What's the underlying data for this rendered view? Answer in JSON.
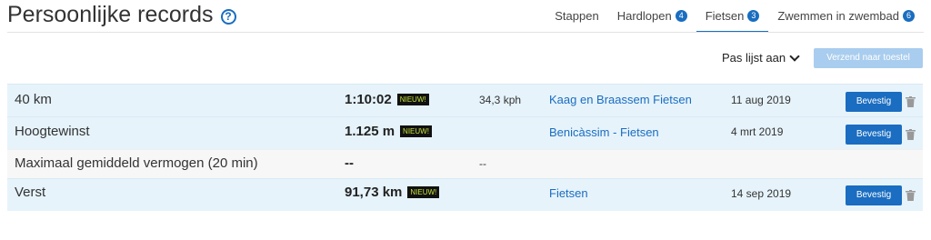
{
  "header": {
    "title": "Persoonlijke records",
    "help_icon": "question-circle-icon"
  },
  "tabs": [
    {
      "label": "Stappen",
      "count": null,
      "active": false
    },
    {
      "label": "Hardlopen",
      "count": "4",
      "active": false
    },
    {
      "label": "Fietsen",
      "count": "3",
      "active": true
    },
    {
      "label": "Zwemmen in zwembad",
      "count": "6",
      "active": false
    }
  ],
  "toolbar": {
    "adjust_label": "Pas lijst aan",
    "send_label": "Verzend naar toestel"
  },
  "rows": [
    {
      "name": "40 km",
      "value": "1:10:02",
      "badge": "NIEUW!",
      "speed": "34,3 kph",
      "activity": "Kaag en Braassem Fietsen",
      "date": "11 aug 2019",
      "confirm": "Bevestig"
    },
    {
      "name": "Hoogtewinst",
      "value": "1.125 m",
      "badge": "NIEUW!",
      "speed": "",
      "activity": "Benicàssim - Fietsen",
      "date": "4 mrt 2019",
      "confirm": "Bevestig"
    },
    {
      "name": "Maximaal gemiddeld vermogen (20 min)",
      "value": "--",
      "badge": "",
      "speed": "--",
      "activity": "",
      "date": "",
      "confirm": ""
    },
    {
      "name": "Verst",
      "value": "91,73 km",
      "badge": "NIEUW!",
      "speed": "",
      "activity": "Fietsen",
      "date": "14 sep 2019",
      "confirm": "Bevestig"
    }
  ],
  "colors": {
    "accent": "#1a6dc0",
    "row_bg": "#e6f3fb",
    "badge_text": "#c7e23a"
  }
}
